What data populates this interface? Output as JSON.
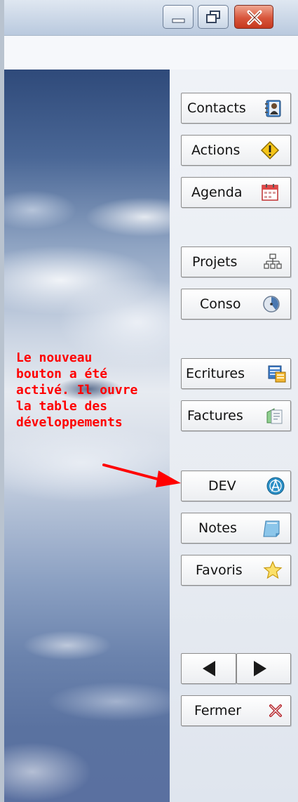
{
  "window": {
    "controls": {
      "minimize_icon": "minimize-icon",
      "restore_icon": "restore-icon",
      "close_icon": "close-icon"
    }
  },
  "sidebar": {
    "buttons": [
      {
        "label": "Contacts",
        "icon": "contacts-book-icon"
      },
      {
        "label": "Actions",
        "icon": "warning-diamond-icon"
      },
      {
        "label": "Agenda",
        "icon": "calendar-icon"
      },
      {
        "label": "Projets",
        "icon": "org-chart-icon"
      },
      {
        "label": "Conso",
        "icon": "clock-icon"
      },
      {
        "label": "Ecritures",
        "icon": "documents-icon"
      },
      {
        "label": "Factures",
        "icon": "invoice-icon"
      },
      {
        "label": "DEV",
        "icon": "compass-icon"
      },
      {
        "label": "Notes",
        "icon": "note-icon"
      },
      {
        "label": "Favoris",
        "icon": "star-icon"
      }
    ],
    "nav": {
      "prev_icon": "triangle-left-icon",
      "next_icon": "triangle-right-icon"
    },
    "close_button": {
      "label": "Fermer",
      "icon": "red-x-icon"
    }
  },
  "annotation": {
    "text": "Le nouveau\nbouton a été\nactivé. Il ouvre\nla table des\ndéveloppements",
    "color": "#ff0000"
  },
  "colors": {
    "annotation": "#ff0000",
    "close_button": "#d8563c"
  }
}
